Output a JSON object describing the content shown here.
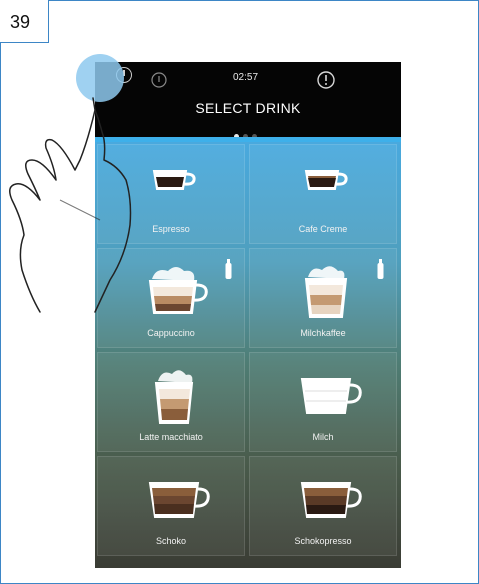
{
  "step": {
    "number": "39"
  },
  "status_bar": {
    "time": "02:57",
    "icons": [
      "power-icon",
      "steam-icon",
      "alert-icon"
    ]
  },
  "screen": {
    "title": "SELECT DRINK",
    "pages": {
      "current": 1,
      "total": 3
    }
  },
  "drinks": [
    {
      "label": "Espresso",
      "icon": "espresso-cup-icon",
      "milk": false
    },
    {
      "label": "Cafe Creme",
      "icon": "cafe-creme-cup-icon",
      "milk": false
    },
    {
      "label": "Cappuccino",
      "icon": "cappuccino-cup-icon",
      "milk": true
    },
    {
      "label": "Milchkaffee",
      "icon": "milchkaffee-glass-icon",
      "milk": true
    },
    {
      "label": "Latte macchiato",
      "icon": "latte-macchiato-glass-icon",
      "milk": false
    },
    {
      "label": "Milch",
      "icon": "milk-cup-icon",
      "milk": false
    },
    {
      "label": "Schoko",
      "icon": "schoko-cup-icon",
      "milk": false
    },
    {
      "label": "Schokopresso",
      "icon": "schokopresso-cup-icon",
      "milk": false
    }
  ],
  "colors": {
    "frame_border": "#3d86c6",
    "header_bg": "#050505",
    "accent_blue": "#3eb0ea",
    "tile_label": "#f2f2f2"
  }
}
